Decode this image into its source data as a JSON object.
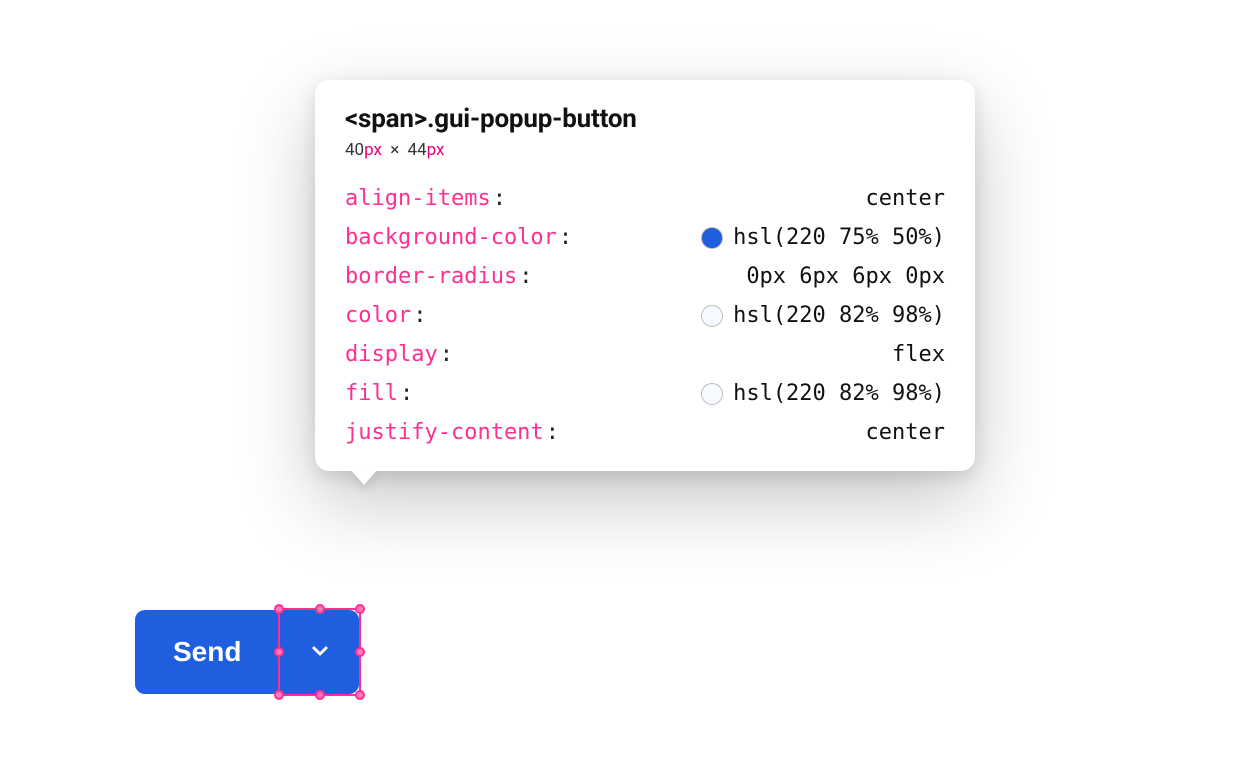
{
  "tooltip": {
    "selector_tag": "<span>",
    "selector_class": ".gui-popup-button",
    "dims": {
      "w": "40",
      "w_unit": "px",
      "times": "×",
      "h": "44",
      "h_unit": "px"
    },
    "props": [
      {
        "name": "align-items",
        "value": "center",
        "swatch": null
      },
      {
        "name": "background-color",
        "value": "hsl(220 75% 50%)",
        "swatch": "#1f5edf"
      },
      {
        "name": "border-radius",
        "value": "0px 6px 6px 0px",
        "swatch": null
      },
      {
        "name": "color",
        "value": "hsl(220 82% 98%)",
        "swatch": "#f6f9fe"
      },
      {
        "name": "display",
        "value": "flex",
        "swatch": null
      },
      {
        "name": "fill",
        "value": "hsl(220 82% 98%)",
        "swatch": "#f6f9fe"
      },
      {
        "name": "justify-content",
        "value": "center",
        "swatch": null
      }
    ]
  },
  "button": {
    "main_label": "Send",
    "popup_icon": "chevron-down"
  },
  "colors": {
    "accent": "#1f5edf",
    "selection": "#ff2f92"
  }
}
